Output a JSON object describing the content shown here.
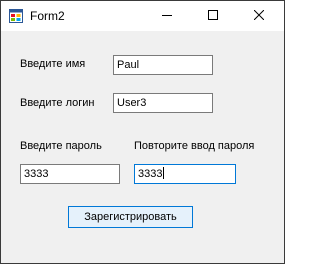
{
  "window": {
    "title": "Form2",
    "icon": "winforms-app-icon",
    "controls": {
      "minimize_icon": "minimize-icon",
      "maximize_icon": "maximize-icon",
      "close_icon": "close-icon"
    }
  },
  "form": {
    "name_label": "Введите имя",
    "name_value": "Paul",
    "login_label": "Введите логин",
    "login_value": "User3",
    "password_label": "Введите пароль",
    "password_value": "3333",
    "repeat_password_label": "Повторите ввод пароля",
    "repeat_password_value": "3333",
    "register_button": "Зарегистрировать"
  },
  "colors": {
    "accent": "#0078d7",
    "button_bg": "#e5f1fb",
    "form_bg": "#f0f0f0"
  }
}
